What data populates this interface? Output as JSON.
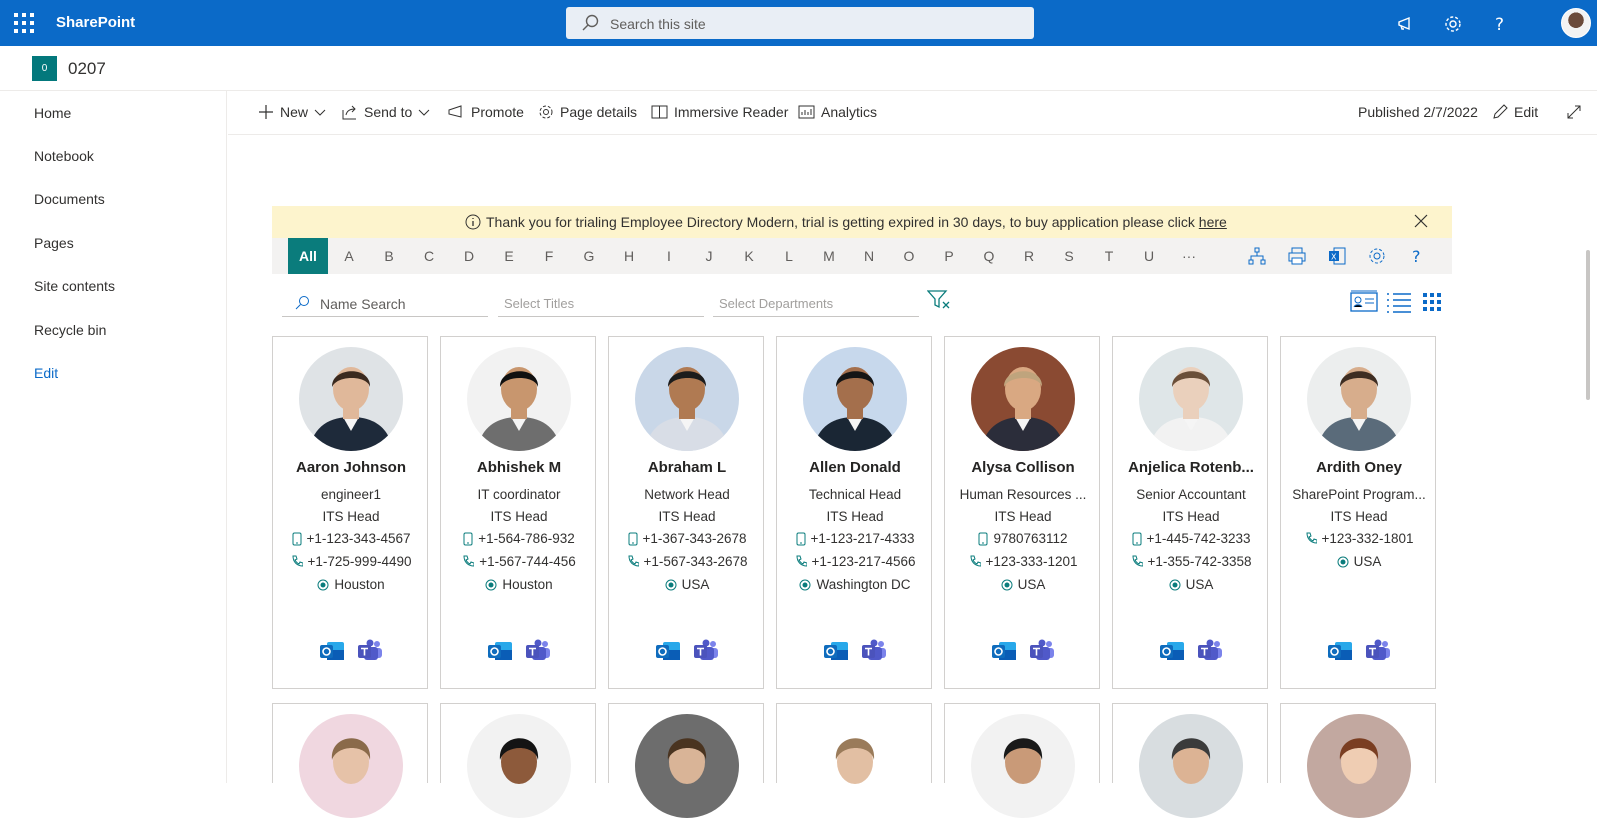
{
  "suitebar": {
    "app_name": "SharePoint",
    "search_placeholder": "Search this site"
  },
  "site": {
    "logo_letter": "0",
    "name": "0207"
  },
  "nav": {
    "items": [
      "Home",
      "Notebook",
      "Documents",
      "Pages",
      "Site contents",
      "Recycle bin"
    ],
    "edit_label": "Edit"
  },
  "commandbar": {
    "new": "New",
    "send_to": "Send to",
    "promote": "Promote",
    "page_details": "Page details",
    "immersive_reader": "Immersive Reader",
    "analytics": "Analytics",
    "published": "Published 2/7/2022",
    "edit": "Edit"
  },
  "banner": {
    "message": "Thank you for trialing Employee Directory Modern, trial is getting expired in 30 days, to buy application please click ",
    "link": "here"
  },
  "alphabet": {
    "all": "All",
    "letters": [
      "A",
      "B",
      "C",
      "D",
      "E",
      "F",
      "G",
      "H",
      "I",
      "J",
      "K",
      "L",
      "M",
      "N",
      "O",
      "P",
      "Q",
      "R",
      "S",
      "T",
      "U"
    ],
    "more": "···"
  },
  "filters": {
    "name_search": "Name Search",
    "titles": "Select Titles",
    "departments": "Select Departments"
  },
  "employees": [
    {
      "name": "Aaron Johnson",
      "title": "engineer1",
      "dept": "ITS Head",
      "mobile": "+1-123-343-4567",
      "phone": "+1-725-999-4490",
      "location": "Houston"
    },
    {
      "name": "Abhishek M",
      "title": "IT coordinator",
      "dept": "ITS Head",
      "mobile": "+1-564-786-932",
      "phone": "+1-567-744-456",
      "location": "Houston"
    },
    {
      "name": "Abraham L",
      "title": "Network Head",
      "dept": "ITS Head",
      "mobile": "+1-367-343-2678",
      "phone": "+1-567-343-2678",
      "location": "USA"
    },
    {
      "name": "Allen Donald",
      "title": "Technical Head",
      "dept": "ITS Head",
      "mobile": "+1-123-217-4333",
      "phone": "+1-123-217-4566",
      "location": "Washington DC"
    },
    {
      "name": "Alysa Collison",
      "title": "Human Resources ...",
      "dept": "ITS Head",
      "mobile": "9780763112",
      "phone": "+123-333-1201",
      "location": "USA"
    },
    {
      "name": "Anjelica Rotenb...",
      "title": "Senior Accountant",
      "dept": "ITS Head",
      "mobile": "+1-445-742-3233",
      "phone": "+1-355-742-3358",
      "location": "USA"
    },
    {
      "name": "Ardith Oney",
      "title": "SharePoint Program...",
      "dept": "ITS Head",
      "mobile": "",
      "phone": "+123-332-1801",
      "location": "USA"
    }
  ]
}
